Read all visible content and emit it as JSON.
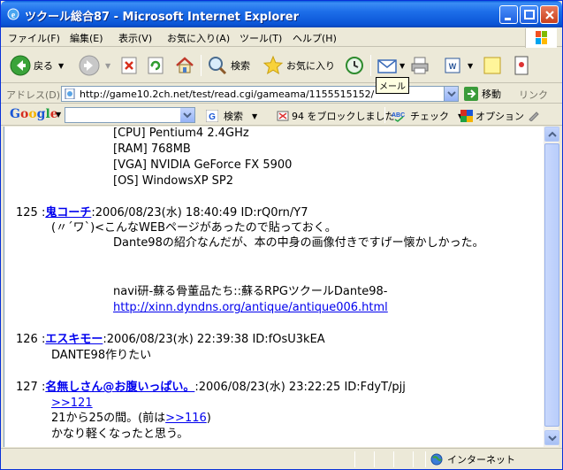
{
  "window": {
    "title": "ツクール総合87 - Microsoft Internet Explorer"
  },
  "menu": [
    "ファイル(F)",
    "編集(E)",
    "表示(V)",
    "お気に入り(A)",
    "ツール(T)",
    "ヘルプ(H)"
  ],
  "toolbar": {
    "back": "戻る",
    "search": "検索",
    "favorites": "お気に入り",
    "tooltip": "メール"
  },
  "address": {
    "label": "アドレス(D)",
    "url": "http://game10.2ch.net/test/read.cgi/gameama/1155515152/",
    "go": "移動",
    "links": "リンク"
  },
  "google": {
    "logo": "Google",
    "search": "検索",
    "blocked": "94 をブロックしました",
    "check": "チェック",
    "options": "オプション"
  },
  "content": {
    "spec_lines": [
      "[CPU] Pentium4 2.4GHz",
      "[RAM] 768MB",
      "[VGA] NVIDIA GeForce FX 5900",
      "[OS] WindowsXP SP2"
    ],
    "post125": {
      "num": "125 :",
      "name": "鬼コーチ",
      "meta": ":2006/08/23(水) 18:40:49 ID:rQ0rn/Y7",
      "line1": "(〃´ワ`)<こんなWEBページがあったので貼っておく。",
      "line2": "Dante98の紹介なんだが、本の中身の画像付きですげー懐かしかった。",
      "line3": "navi研-蘇る骨董品たち::蘇るRPGツクールDante98-",
      "link": "http://xinn.dyndns.org/antique/antique006.html"
    },
    "post126": {
      "num": "126 :",
      "name": "エスキモー",
      "meta": ":2006/08/23(水) 22:39:38 ID:fOsU3kEA",
      "line1": "DANTE98作りたい"
    },
    "post127": {
      "num": "127 :",
      "name": "名無しさん@お腹いっぱい。",
      "meta": ":2006/08/23(水) 23:22:25 ID:FdyT/pjj",
      "ref": ">>121",
      "line1_pre": "21から25の間。(前は",
      "line1_ref": ">>116",
      "line1_post": ")",
      "line2": "かなり軽くなったと思う。"
    }
  },
  "status": {
    "zone": "インターネット"
  },
  "colors": {
    "titlebar": "#0a55d6",
    "link": "#0000ee",
    "chrome": "#ece9d8"
  }
}
